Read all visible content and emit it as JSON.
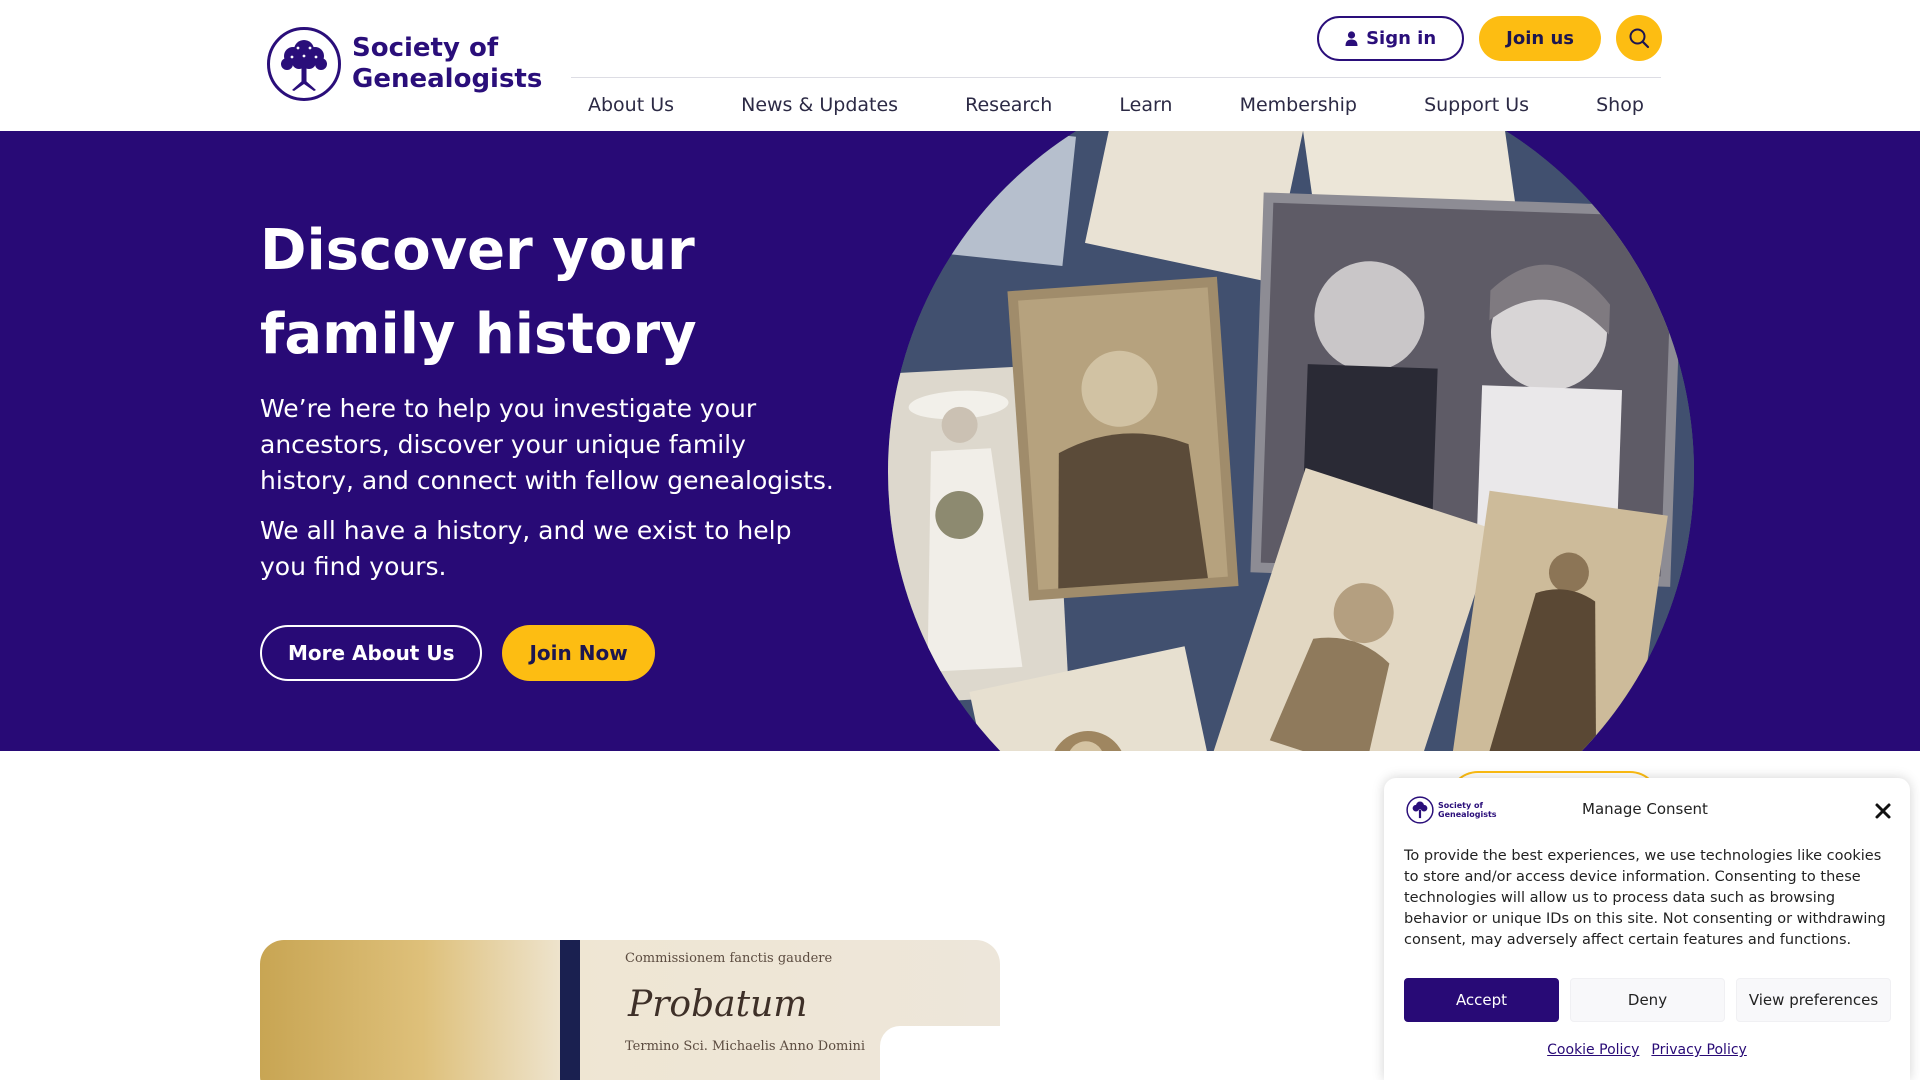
{
  "header": {
    "logo_line1": "Society of",
    "logo_line2": "Genealogists",
    "signin_label": "Sign in",
    "join_label": "Join us",
    "nav": [
      "About Us",
      "News & Updates",
      "Research",
      "Learn",
      "Membership",
      "Support Us",
      "Shop"
    ]
  },
  "hero": {
    "title_line1": "Discover your",
    "title_line2": "family history",
    "para1": "We’re here to help you investigate your ancestors, discover your unique family history, and connect with fellow genealogists.",
    "para2": "We all have a history, and we exist to help you find yours.",
    "btn_more": "More About Us",
    "btn_join": "Join Now"
  },
  "consent": {
    "logo_line1": "Society of",
    "logo_line2": "Genealogists",
    "title": "Manage Consent",
    "body": "To provide the best experiences, we use technologies like cookies to store and/or access device information. Consenting to these technologies will allow us to process data such as browsing behavior or unique IDs on this site. Not consenting or withdrawing consent, may adversely affect certain features and functions.",
    "accept": "Accept",
    "deny": "Deny",
    "preferences": "View preferences",
    "cookie_policy": "Cookie Policy",
    "privacy_policy": "Privacy Policy"
  },
  "document_image": {
    "handwriting_line1": "Commissionem fanctis gaudere",
    "handwriting_word": "Probatum",
    "handwriting_line2": "Termino Sci. Michaelis Anno Domini"
  },
  "colors": {
    "brand_purple": "#280a76",
    "accent_yellow": "#fdbd12"
  },
  "icons": [
    "tree-logo-icon",
    "user-icon",
    "search-icon",
    "close-icon"
  ]
}
